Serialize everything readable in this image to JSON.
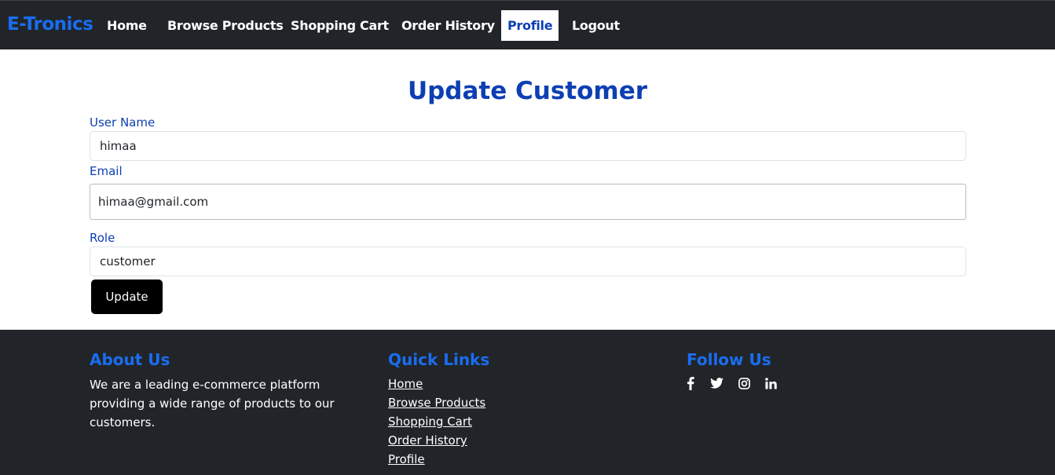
{
  "nav": {
    "brand": "E-Tronics",
    "links": [
      "Home",
      "Browse Products",
      "Shopping Cart",
      "Order History",
      "Profile",
      "Logout"
    ]
  },
  "form": {
    "title": "Update Customer",
    "username_label": "User Name",
    "username_value": "himaa",
    "email_label": "Email",
    "email_value": "himaa@gmail.com",
    "role_label": "Role",
    "role_value": "customer",
    "update_label": "Update"
  },
  "footer": {
    "about_heading": "About Us",
    "about_text": "We are a leading e-commerce platform providing a wide range of products to our customers.",
    "quick_heading": "Quick Links",
    "quick_links": [
      "Home",
      "Browse Products",
      "Shopping Cart",
      "Order History",
      "Profile"
    ],
    "follow_heading": "Follow Us",
    "social_icons": [
      "facebook-icon",
      "twitter-icon",
      "instagram-icon",
      "linkedin-icon"
    ]
  },
  "colors": {
    "nav_bg": "#212529",
    "brand": "#1a6df0",
    "heading_blue": "#0d3fb3",
    "button": "#000000"
  }
}
